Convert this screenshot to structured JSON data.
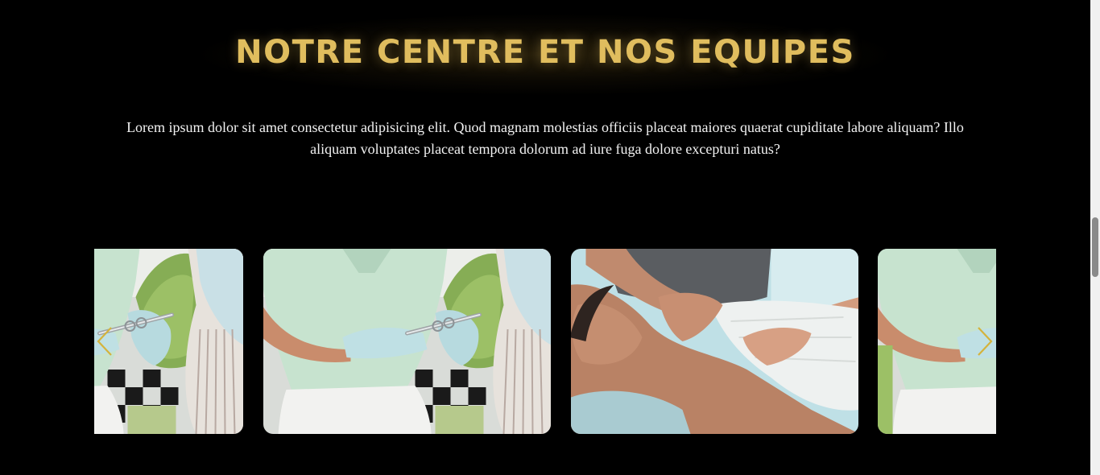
{
  "section": {
    "title": "NOTRE CENTRE ET NOS EQUIPES",
    "description": "Lorem ipsum dolor sit amet consectetur adipisicing elit. Quod magnam molestias officiis placeat maiores quaerat cupiditate labore aliquam? Illo aliquam voluptates placeat tempora dolorum ad iure fuga dolore excepturi natus?"
  },
  "carousel": {
    "slides": [
      {
        "image": "dental-injection-photo"
      },
      {
        "image": "dental-injection-photo"
      },
      {
        "image": "massage-therapy-photo"
      },
      {
        "image": "dental-injection-photo"
      }
    ],
    "prev_icon": "chevron-left-icon",
    "next_icon": "chevron-right-icon"
  },
  "colors": {
    "background": "#000000",
    "title": "#e0bd5e",
    "text": "#f2f2f2",
    "arrow": "#d4b33c"
  }
}
